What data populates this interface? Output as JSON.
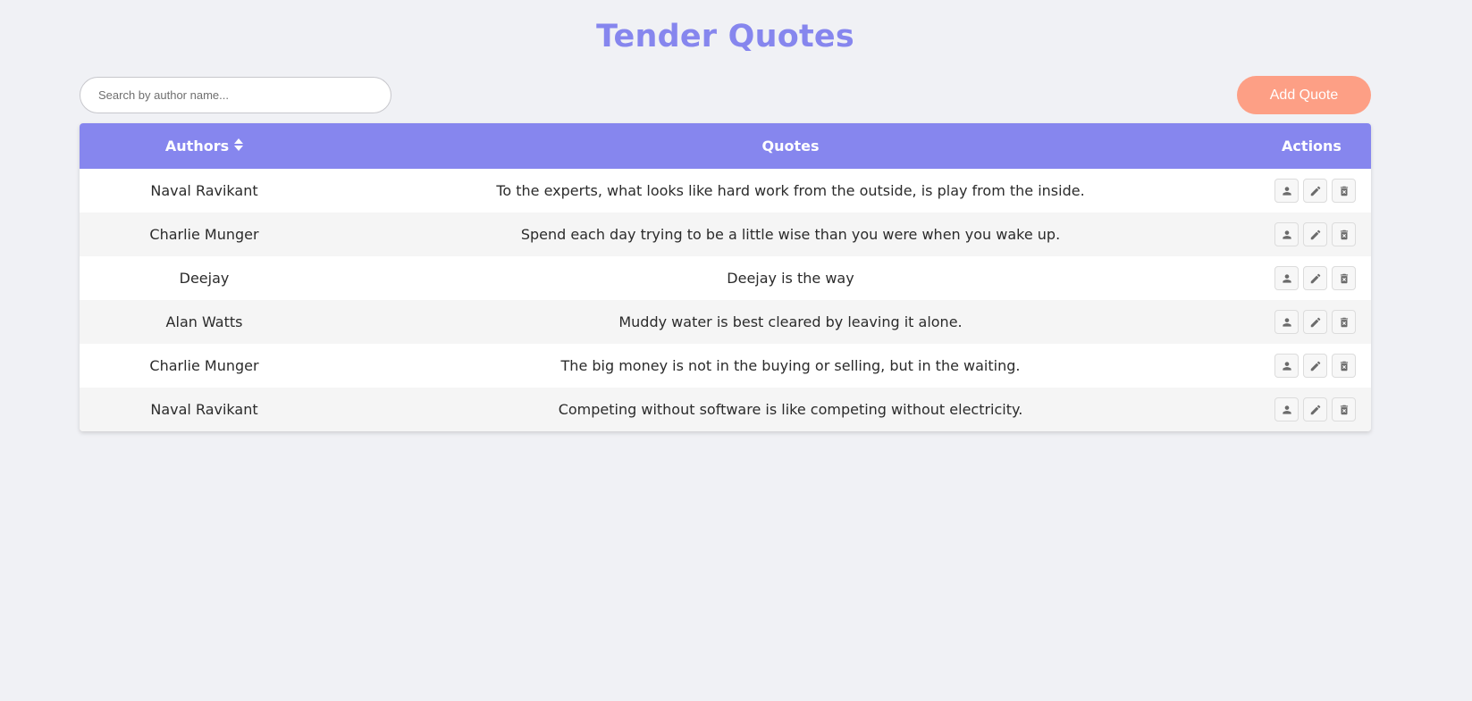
{
  "header": {
    "title": "Tender Quotes"
  },
  "toolbar": {
    "search_placeholder": "Search by author name...",
    "search_value": "",
    "add_button_label": "Add Quote"
  },
  "table": {
    "columns": {
      "author": "Authors",
      "quote": "Quotes",
      "actions": "Actions"
    },
    "sort_icon": "sort-icon",
    "action_icons": [
      "user-icon",
      "edit-icon",
      "delete-icon"
    ],
    "rows": [
      {
        "author": "Naval Ravikant",
        "quote": "To the experts, what looks like hard work from the outside, is play from the inside."
      },
      {
        "author": "Charlie Munger",
        "quote": "Spend each day trying to be a little wise than you were when you wake up."
      },
      {
        "author": "Deejay",
        "quote": "Deejay is the way"
      },
      {
        "author": "Alan Watts",
        "quote": "Muddy water is best cleared by leaving it alone."
      },
      {
        "author": "Charlie Munger",
        "quote": "The big money is not in the buying or selling, but in the waiting."
      },
      {
        "author": "Naval Ravikant",
        "quote": "Competing without software is like competing without electricity."
      }
    ]
  },
  "colors": {
    "accent": "#8686ee",
    "button": "#fd9f85",
    "background": "#f0f1f5"
  }
}
